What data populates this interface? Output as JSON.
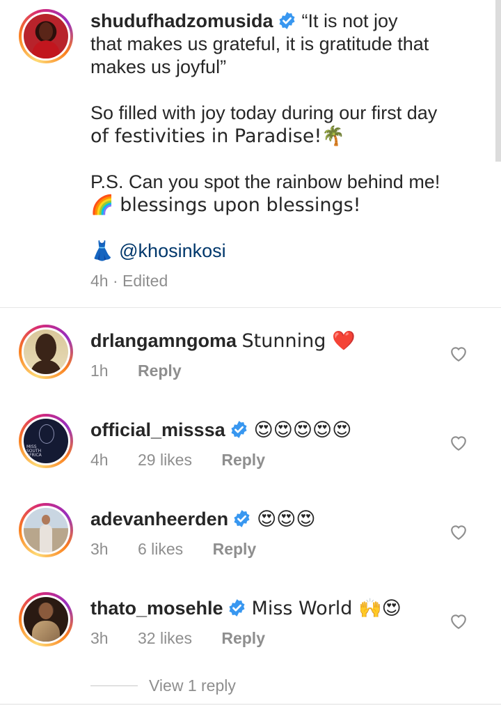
{
  "caption": {
    "username": "shudufhadzomusida",
    "paragraphs": [
      "“It is not joy that makes us grateful, it is gratitude that makes us joyful”",
      "So filled with joy today during our first day of festivities in Paradise!🌴",
      "P.S. Can you spot the rainbow behind me! 🌈 blessings upon blessings!"
    ],
    "quote_line1": "“It is not joy",
    "quote_line2": "that makes us grateful, it is gratitude that",
    "quote_line3": "makes us joyful”",
    "para2_line1": "So filled with joy today during our first day",
    "para2_line2": "of festivities in Paradise!🌴",
    "para3_line1": "P.S. Can you spot the rainbow behind me!",
    "para3_line2": "🌈 blessings upon blessings!",
    "dress_emoji": "👗",
    "mention": "@khosinkosi",
    "time": "4h",
    "edited": "Edited",
    "time_edited": "4h · Edited"
  },
  "comments": [
    {
      "username": "drlangamngoma",
      "verified": false,
      "text": "Stunning ❤️",
      "time": "1h",
      "likes": "",
      "reply": "Reply"
    },
    {
      "username": "official_misssa",
      "verified": true,
      "text": "😍😍😍😍😍",
      "time": "4h",
      "likes": "29 likes",
      "reply": "Reply"
    },
    {
      "username": "adevanheerden",
      "verified": true,
      "text": "😍😍😍",
      "time": "3h",
      "likes": "6 likes",
      "reply": "Reply"
    },
    {
      "username": "thato_mosehle",
      "verified": true,
      "text": "Miss World 🙌😍",
      "time": "3h",
      "likes": "32 likes",
      "reply": "Reply"
    }
  ],
  "view_replies": "View 1 reply",
  "colors": {
    "verified_blue": "#3897f0",
    "meta_gray": "#8e8e8e",
    "mention_blue": "#00376b",
    "heart_red": "#ed4956"
  }
}
